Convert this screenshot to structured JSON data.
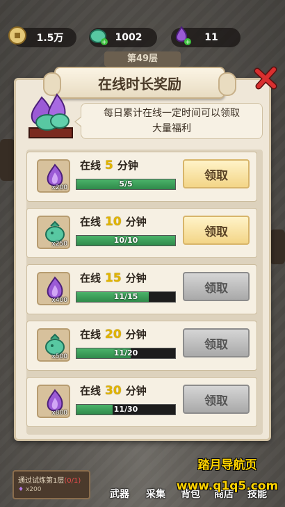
{
  "resources": [
    {
      "icon": "gold-coin-icon",
      "value": "1.5万"
    },
    {
      "icon": "green-crystal-icon",
      "value": "1002"
    },
    {
      "icon": "purple-flame-icon",
      "value": "11"
    }
  ],
  "floor_label": "第49层",
  "panel": {
    "title": "在线时长奖励",
    "tip_line1": "每日累计在线一定时间可以领取",
    "tip_line2": "大量福利"
  },
  "rewards": [
    {
      "prefix": "在线",
      "minutes": "5",
      "suffix": "分钟",
      "item_icon": "purple-flame-icon",
      "qty": "x200",
      "progress_text": "5/5",
      "progress_fraction": 1.0,
      "button": "领取",
      "state": "active"
    },
    {
      "prefix": "在线",
      "minutes": "10",
      "suffix": "分钟",
      "item_icon": "green-crystal-icon",
      "qty": "x250",
      "progress_text": "10/10",
      "progress_fraction": 1.0,
      "button": "领取",
      "state": "active"
    },
    {
      "prefix": "在线",
      "minutes": "15",
      "suffix": "分钟",
      "item_icon": "purple-flame-icon",
      "qty": "x400",
      "progress_text": "11/15",
      "progress_fraction": 0.733,
      "button": "领取",
      "state": "disabled"
    },
    {
      "prefix": "在线",
      "minutes": "20",
      "suffix": "分钟",
      "item_icon": "green-crystal-icon",
      "qty": "x500",
      "progress_text": "11/20",
      "progress_fraction": 0.55,
      "button": "领取",
      "state": "disabled"
    },
    {
      "prefix": "在线",
      "minutes": "30",
      "suffix": "分钟",
      "item_icon": "purple-flame-icon",
      "qty": "x800",
      "progress_text": "11/30",
      "progress_fraction": 0.367,
      "button": "领取",
      "state": "disabled"
    }
  ],
  "bottom": {
    "task_title": "通过试炼第1层",
    "task_progress": "(0/1)",
    "task_reward": "x200",
    "nav": [
      "武器",
      "采集",
      "背包",
      "商店",
      "技能"
    ]
  },
  "watermark": {
    "line1": "踏月导航页",
    "line2": "www.q1q5.com"
  },
  "colors": {
    "accent_yellow": "#e0b400",
    "progress_green": "#3f9f5c",
    "panel_bg": "#efe7d8"
  }
}
